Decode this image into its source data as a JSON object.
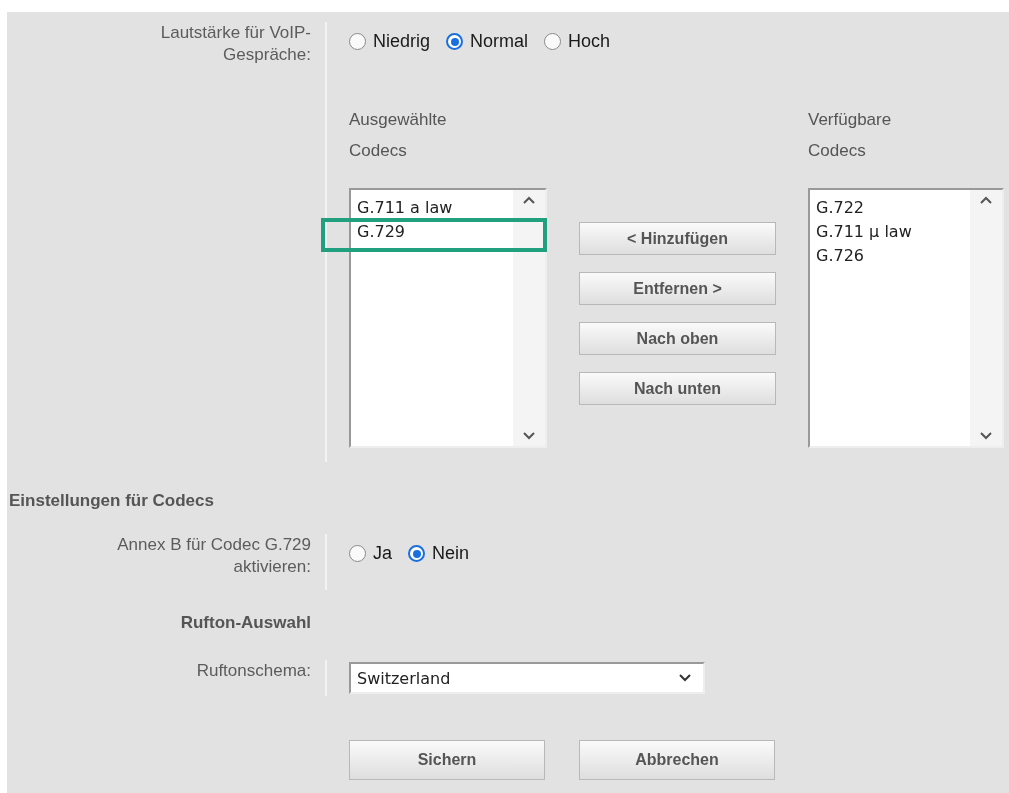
{
  "volume": {
    "label": "Lautstärke für VoIP-Gespräche:",
    "options": [
      {
        "label": "Niedrig",
        "selected": false
      },
      {
        "label": "Normal",
        "selected": true
      },
      {
        "label": "Hoch",
        "selected": false
      }
    ]
  },
  "codecs": {
    "selected_heading": "Ausgewählte Codecs",
    "available_heading": "Verfügbare Codecs",
    "selected_list": [
      {
        "label": "G.711 a law",
        "highlighted": false
      },
      {
        "label": "G.729",
        "highlighted": true
      }
    ],
    "available_list": [
      {
        "label": "G.722",
        "highlighted": false
      },
      {
        "label": "G.711 µ law",
        "highlighted": false
      },
      {
        "label": "G.726",
        "highlighted": false
      }
    ],
    "buttons": [
      "< Hinzufügen",
      "Entfernen >",
      "Nach oben",
      "Nach unten"
    ]
  },
  "codec_settings": {
    "heading": "Einstellungen für Codecs",
    "label": "Annex B für Codec G.729 aktivieren:",
    "options": [
      {
        "label": "Ja",
        "selected": false
      },
      {
        "label": "Nein",
        "selected": true
      }
    ]
  },
  "ringtone": {
    "heading": "Rufton-Auswahl",
    "label": "Ruftonschema:",
    "value": "Switzerland"
  },
  "buttons": [
    "Sichern",
    "Abbrechen"
  ]
}
